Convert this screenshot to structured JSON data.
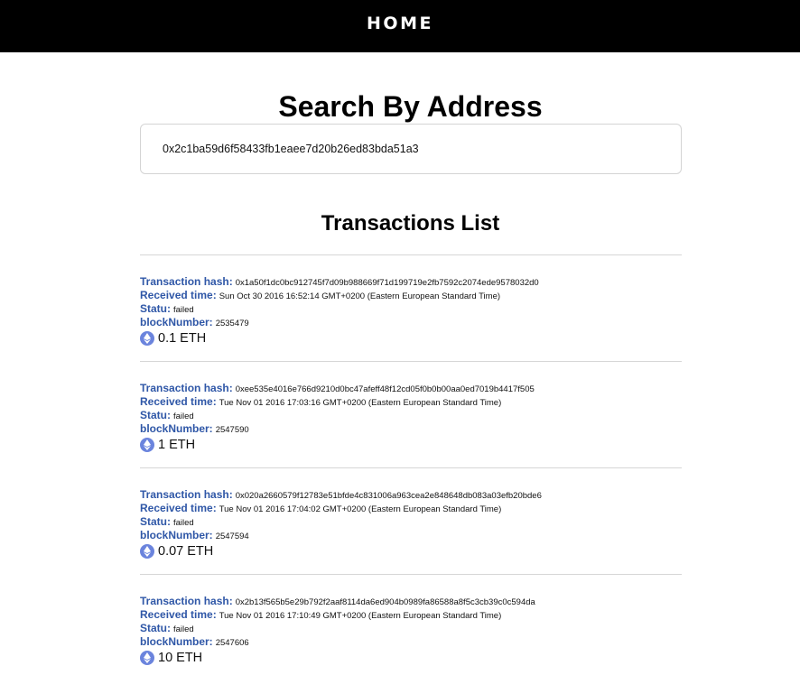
{
  "nav": {
    "home_label": "HOME"
  },
  "search": {
    "title": "Search By Address",
    "value": "0x2c1ba59d6f58433fb1eaee7d20b26ed83bda51a3"
  },
  "transactions": {
    "title": "Transactions List",
    "labels": {
      "hash": "Transaction hash:",
      "time": "Received time:",
      "status": "Statu:",
      "block": "blockNumber:"
    },
    "items": [
      {
        "hash": "0x1a50f1dc0bc912745f7d09b988669f71d199719e2fb7592c2074ede9578032d0",
        "time": "Sun Oct 30 2016 16:52:14 GMT+0200 (Eastern European Standard Time)",
        "status": "failed",
        "block": "2535479",
        "amount": "0.1 ETH"
      },
      {
        "hash": "0xee535e4016e766d9210d0bc47afeff48f12cd05f0b0b00aa0ed7019b4417f505",
        "time": "Tue Nov 01 2016 17:03:16 GMT+0200 (Eastern European Standard Time)",
        "status": "failed",
        "block": "2547590",
        "amount": "1 ETH"
      },
      {
        "hash": "0x020a2660579f12783e51bfde4c831006a963cea2e848648db083a03efb20bde6",
        "time": "Tue Nov 01 2016 17:04:02 GMT+0200 (Eastern European Standard Time)",
        "status": "failed",
        "block": "2547594",
        "amount": "0.07 ETH"
      },
      {
        "hash": "0x2b13f565b5e29b792f2aaf8114da6ed904b0989fa86588a8f5c3cb39c0c594da",
        "time": "Tue Nov 01 2016 17:10:49 GMT+0200 (Eastern European Standard Time)",
        "status": "failed",
        "block": "2547606",
        "amount": "10 ETH"
      }
    ]
  },
  "icons": {
    "currency": "ethereum-icon"
  },
  "colors": {
    "topbar": "#000000",
    "label": "#2f57a7",
    "eth_icon": "#6b84dd"
  }
}
